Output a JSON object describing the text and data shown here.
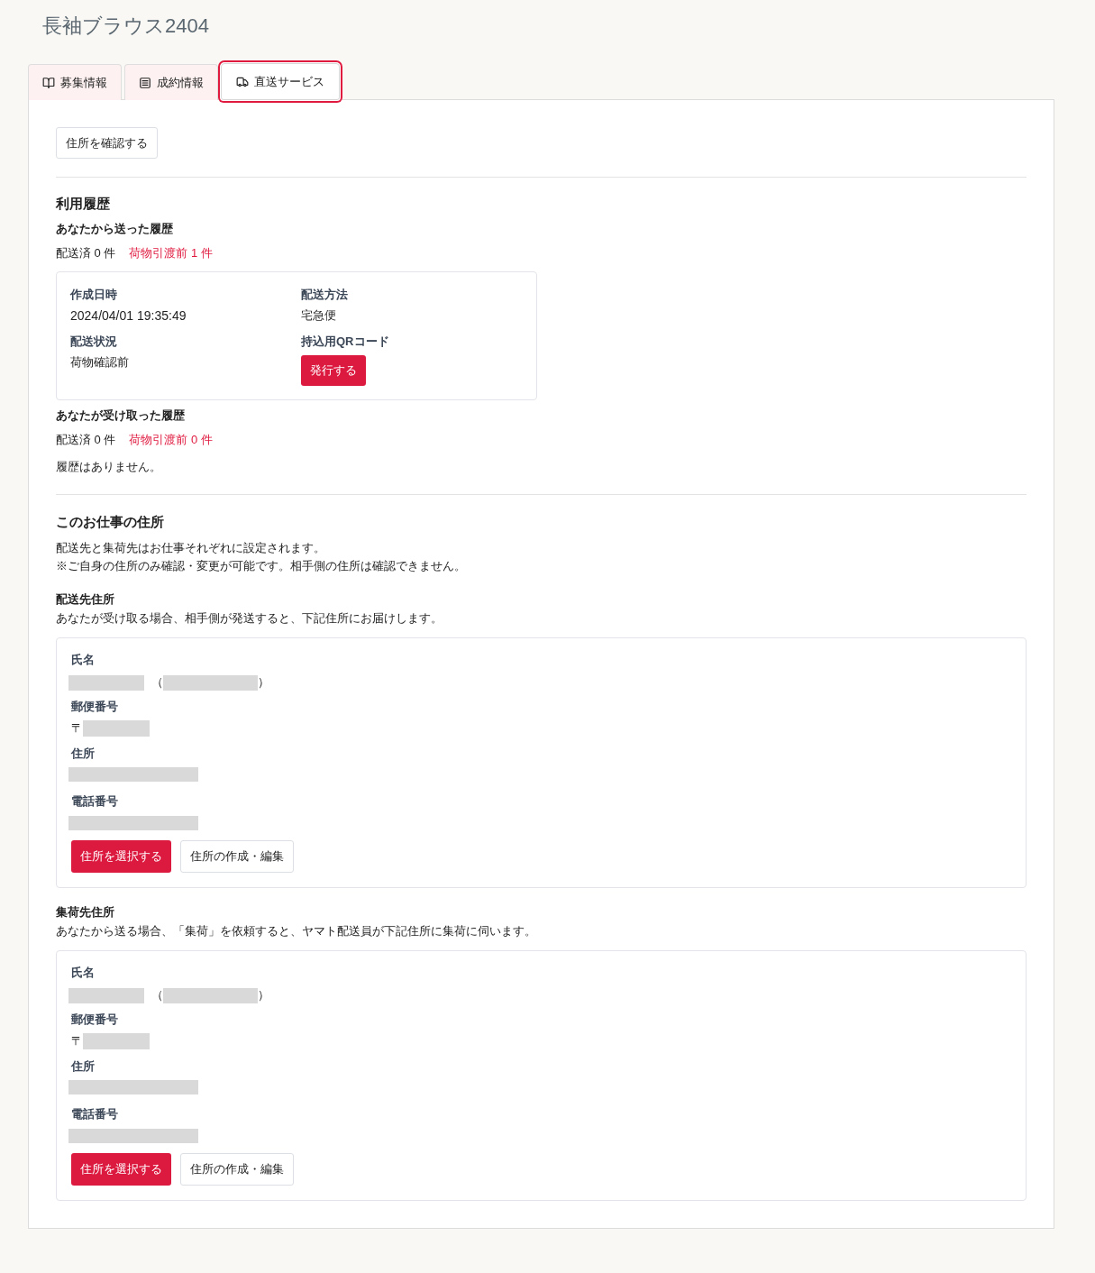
{
  "page_title": "長袖ブラウス2404",
  "tabs": [
    {
      "label": "募集情報",
      "selected": false
    },
    {
      "label": "成約情報",
      "selected": false
    },
    {
      "label": "直送サービス",
      "selected": true
    }
  ],
  "confirm_address_button": "住所を確認する",
  "usage_history": {
    "heading": "利用履歴",
    "sent": {
      "heading": "あなたから送った履歴",
      "delivered": "配送済 0 件",
      "pending": "荷物引渡前 1 件",
      "records": [
        {
          "created_label": "作成日時",
          "created": "2024/04/01 19:35:49",
          "method_label": "配送方法",
          "method": "宅急便",
          "status_label": "配送状況",
          "status": "荷物確認前",
          "qr_label": "持込用QRコード",
          "qr_button": "発行する"
        }
      ]
    },
    "received": {
      "heading": "あなたが受け取った履歴",
      "delivered": "配送済 0 件",
      "pending": "荷物引渡前 0 件",
      "empty_message": "履歴はありません。"
    }
  },
  "job_addresses": {
    "heading": "このお仕事の住所",
    "description": [
      "配送先と集荷先はお仕事それぞれに設定されます。",
      "※ご自身の住所のみ確認・変更が可能です。相手側の住所は確認できません。"
    ],
    "sections": [
      {
        "heading": "配送先住所",
        "description": "あなたが受け取る場合、相手側が発送すると、下記住所にお届けします。",
        "name_label": "氏名",
        "name_open": "（",
        "name_close": "）",
        "postal_label": "郵便番号",
        "postal_mark": "〒",
        "address_label": "住所",
        "phone_label": "電話番号",
        "select_button": "住所を選択する",
        "edit_button": "住所の作成・編集"
      },
      {
        "heading": "集荷先住所",
        "description": "あなたから送る場合、「集荷」を依頼すると、ヤマト配送員が下記住所に集荷に伺います。",
        "name_label": "氏名",
        "name_open": "（",
        "name_close": "）",
        "postal_label": "郵便番号",
        "postal_mark": "〒",
        "address_label": "住所",
        "phone_label": "電話番号",
        "select_button": "住所を選択する",
        "edit_button": "住所の作成・編集"
      }
    ]
  }
}
